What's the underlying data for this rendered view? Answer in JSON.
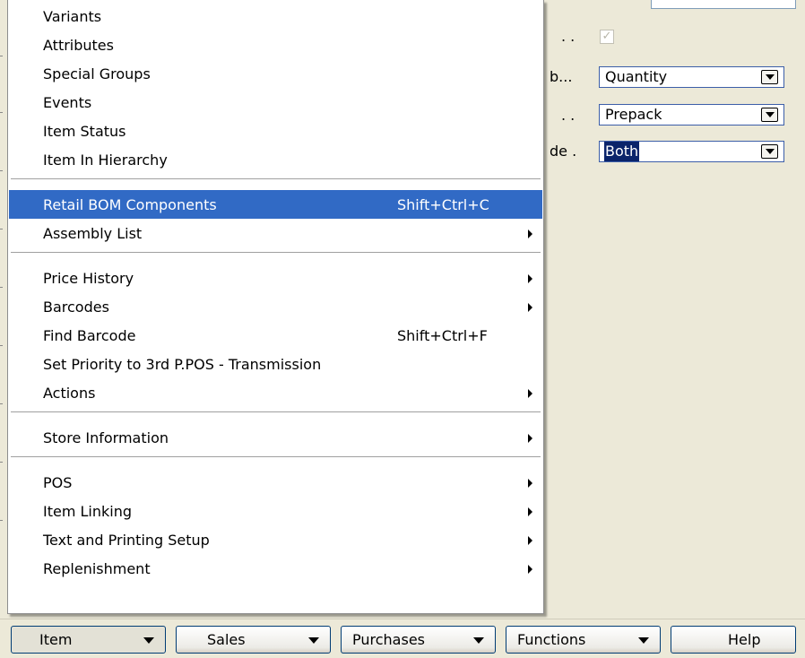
{
  "form": {
    "labels": [
      ". .",
      "b...",
      ". .",
      "de ."
    ],
    "checkbox_mark": "✓",
    "combos": [
      {
        "value": "Quantity"
      },
      {
        "value": "Prepack"
      },
      {
        "value": "Both"
      }
    ]
  },
  "menu": {
    "groups": [
      {
        "items": [
          {
            "label": "Variants"
          },
          {
            "label": "Attributes"
          },
          {
            "label": "Special Groups"
          },
          {
            "label": "Events"
          },
          {
            "label": "Item Status"
          },
          {
            "label": "Item In Hierarchy"
          }
        ]
      },
      {
        "items": [
          {
            "label": "Retail BOM Components",
            "shortcut": "Shift+Ctrl+C",
            "highlighted": true
          },
          {
            "label": "Assembly List",
            "submenu": true
          }
        ]
      },
      {
        "items": [
          {
            "label": "Price History",
            "submenu": true
          },
          {
            "label": "Barcodes",
            "submenu": true
          },
          {
            "label": "Find Barcode",
            "shortcut": "Shift+Ctrl+F"
          },
          {
            "label": "Set Priority to 3rd P.POS - Transmission"
          },
          {
            "label": "Actions",
            "submenu": true
          }
        ]
      },
      {
        "items": [
          {
            "label": "Store Information",
            "submenu": true
          }
        ]
      },
      {
        "items": [
          {
            "label": "POS",
            "submenu": true
          },
          {
            "label": "Item Linking",
            "submenu": true
          },
          {
            "label": "Text and Printing Setup",
            "submenu": true
          },
          {
            "label": "Replenishment",
            "submenu": true
          }
        ]
      }
    ]
  },
  "tabs": [
    {
      "label": "Item",
      "has_dropdown": true,
      "pressed": true
    },
    {
      "label": "Sales",
      "has_dropdown": true
    },
    {
      "label": "Purchases",
      "has_dropdown": true
    },
    {
      "label": "Functions",
      "has_dropdown": true
    },
    {
      "label": "Help",
      "has_dropdown": false
    }
  ],
  "colors": {
    "menu_highlight": "#316ac5",
    "selection": "#0a246a",
    "window_bg": "#ece9d8"
  }
}
